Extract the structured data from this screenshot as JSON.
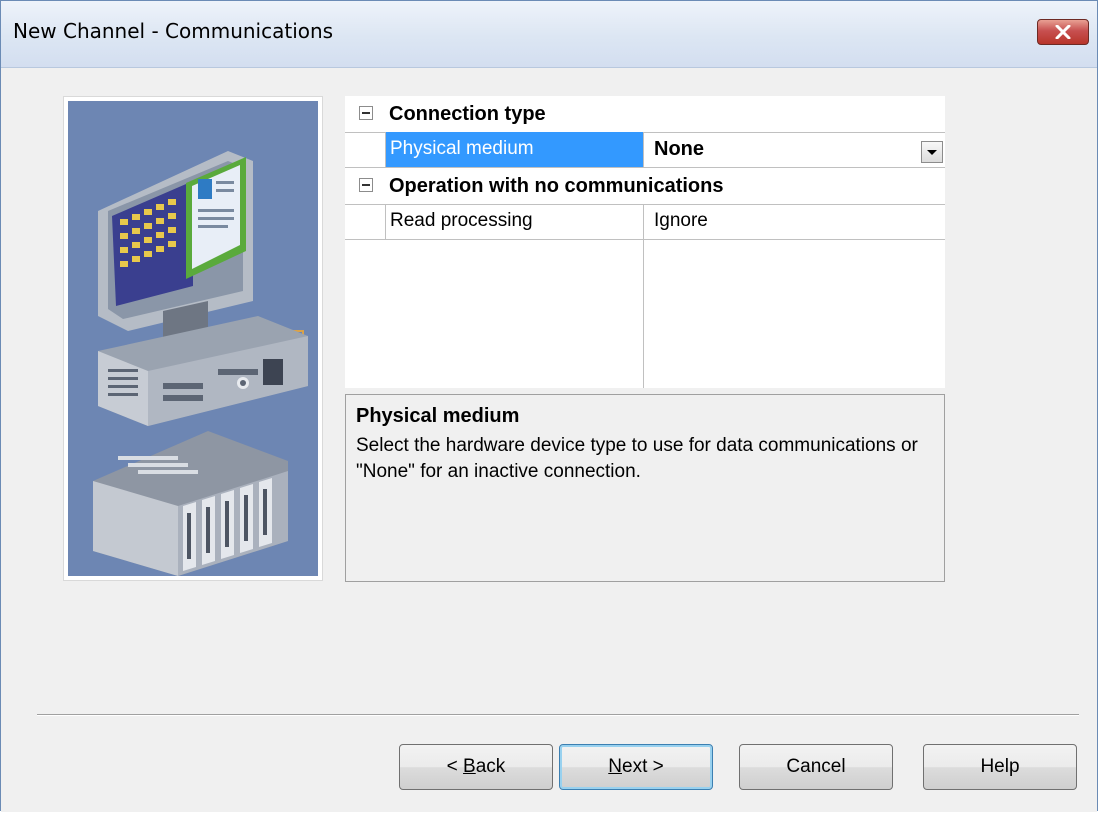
{
  "window": {
    "title": "New Channel - Communications",
    "close_label": "X"
  },
  "property_grid": {
    "categories": [
      {
        "label": "Connection type",
        "properties": [
          {
            "name": "Physical medium",
            "value": "None",
            "selected": true,
            "has_dropdown": true
          }
        ]
      },
      {
        "label": "Operation with no communications",
        "properties": [
          {
            "name": "Read processing",
            "value": "Ignore",
            "selected": false,
            "has_dropdown": false
          }
        ]
      }
    ]
  },
  "description": {
    "title": "Physical medium",
    "text": "Select the hardware device type to use for data communications or \"None\" for an inactive connection."
  },
  "buttons": {
    "back_prefix": "< ",
    "back_mnemonic": "B",
    "back_rest": "ack",
    "next_mnemonic": "N",
    "next_rest": "ext >",
    "cancel": "Cancel",
    "help": "Help"
  },
  "colors": {
    "selection": "#3399ff",
    "illustration_bg": "#6d86b3",
    "close_button": "#c75050"
  },
  "icons": {
    "close": "close-icon",
    "collapse": "collapse-icon",
    "dropdown": "chevron-down-icon",
    "illustration": "computer-plc-illustration"
  }
}
